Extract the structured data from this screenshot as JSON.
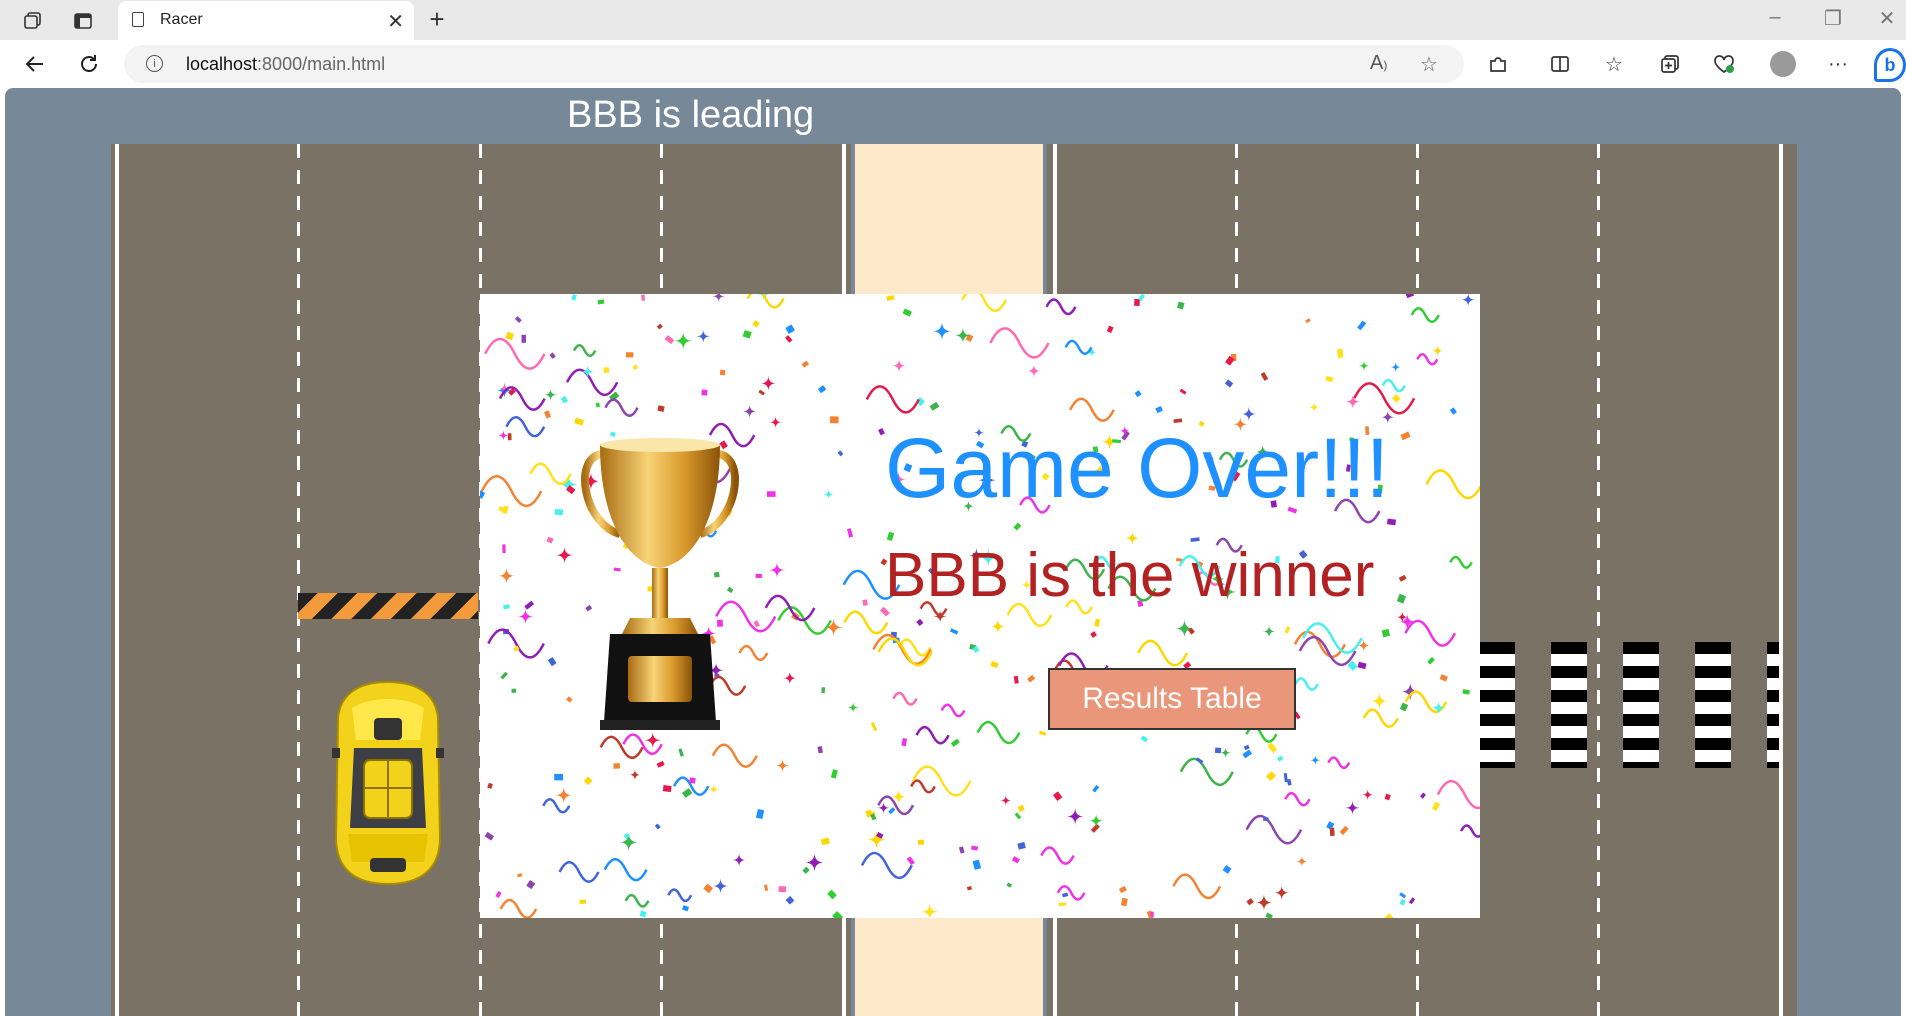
{
  "browser": {
    "tab_title": "Racer",
    "url_host": "localhost",
    "url_rest": ":8000/main.html",
    "icons": [
      "workspaces-icon",
      "tab-actions-icon",
      "page-icon",
      "close-icon",
      "new-tab-icon",
      "minimize-icon",
      "restore-icon",
      "close-window-icon",
      "back-icon",
      "refresh-icon",
      "info-icon",
      "read-aloud-icon",
      "favorite-icon",
      "extensions-icon",
      "split-screen-icon",
      "favorites-icon",
      "collections-icon",
      "browser-essentials-icon",
      "profile-icon",
      "more-icon",
      "copilot-icon"
    ]
  },
  "game": {
    "leading_text": "BBB is leading",
    "colors": {
      "background": "#778899",
      "road": "#7a7265",
      "median": "#feeacb",
      "barrier_stripe": "#f39a3c",
      "car": "#f2d21a"
    }
  },
  "modal": {
    "title": "Game Over!!!",
    "winner_text": "BBB is the winner",
    "button_label": "Results Table",
    "colors": {
      "title": "#1e90ff",
      "winner": "#b22222",
      "button": "#e9967a"
    }
  }
}
